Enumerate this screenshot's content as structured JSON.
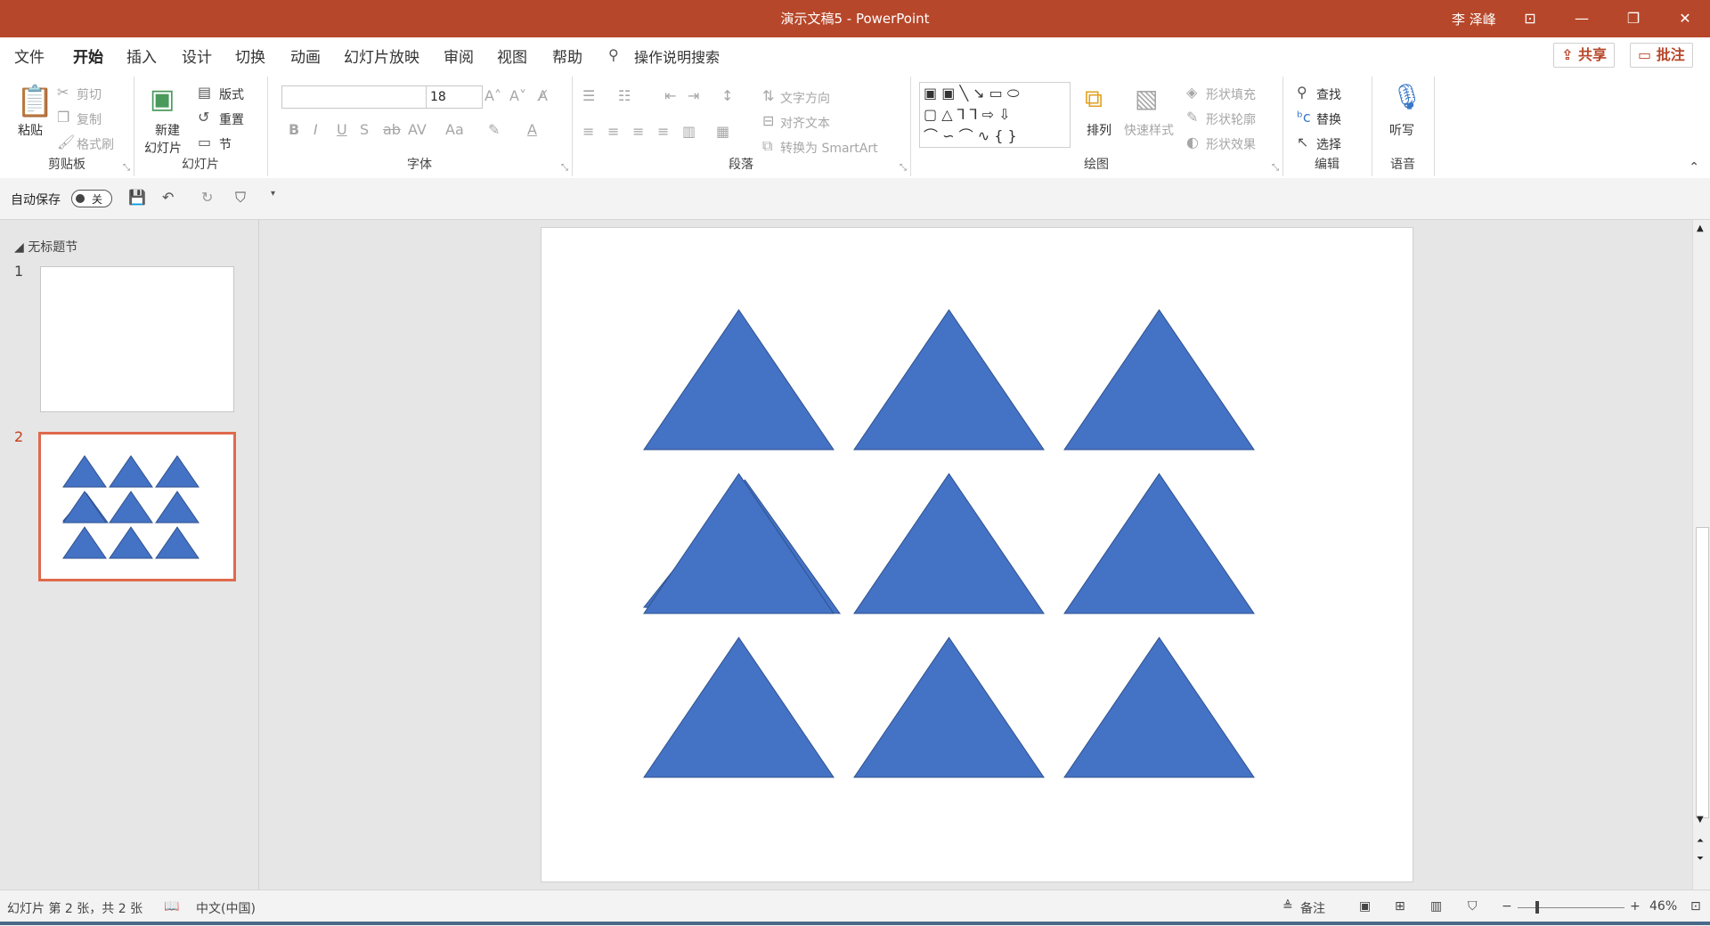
{
  "window": {
    "title": "演示文稿5  -  PowerPoint",
    "user": "李 泽峰",
    "controls": {
      "ribbon_display": "⊡",
      "minimize": "—",
      "restore": "❐",
      "close": "✕"
    }
  },
  "tabs": [
    "文件",
    "开始",
    "插入",
    "设计",
    "切换",
    "动画",
    "幻灯片放映",
    "审阅",
    "视图",
    "帮助"
  ],
  "active_tab": "开始",
  "tell_me": "操作说明搜索",
  "share_label": "共享",
  "comment_label": "批注",
  "ribbon": {
    "clipboard": {
      "label": "剪贴板",
      "paste": "粘贴",
      "cut": "剪切",
      "copy": "复制",
      "format_painter": "格式刷"
    },
    "slides": {
      "label": "幻灯片",
      "new_slide_1": "新建",
      "new_slide_2": "幻灯片",
      "layout": "版式",
      "reset": "重置",
      "section": "节"
    },
    "font": {
      "label": "字体",
      "font_name": "",
      "font_size": "18"
    },
    "paragraph": {
      "label": "段落",
      "text_direction": "文字方向",
      "align_text": "对齐文本",
      "smartart": "转换为 SmartArt"
    },
    "drawing": {
      "label": "绘图",
      "arrange": "排列",
      "quick_styles": "快速样式",
      "shape_fill": "形状填充",
      "shape_outline": "形状轮廓",
      "shape_effects": "形状效果"
    },
    "editing": {
      "label": "编辑",
      "find": "查找",
      "replace": "替换",
      "select": "选择"
    },
    "voice": {
      "label": "语音",
      "dictate": "听写"
    }
  },
  "qat": {
    "autosave": "自动保存",
    "autosave_state": "关"
  },
  "thumbnails": {
    "section": "无标题节",
    "slides": [
      {
        "number": "1"
      },
      {
        "number": "2"
      }
    ],
    "selected": "2"
  },
  "slide": {
    "shape_color": "#4472c4",
    "shape_outline": "#2f528f",
    "shape": "isosceles-triangle",
    "rows": 3,
    "cols": 3
  },
  "status": {
    "slide_info": "幻灯片 第 2 张，共 2 张",
    "language": "中文(中国)",
    "notes": "备注",
    "zoom": "46%"
  },
  "colors": {
    "accent": "#b7472a",
    "selection": "#e0694c"
  }
}
